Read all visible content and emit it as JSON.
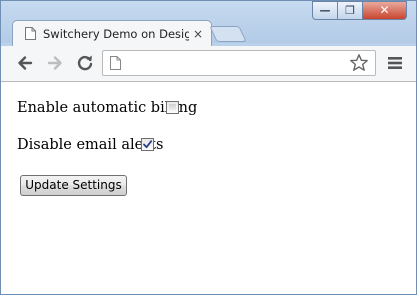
{
  "browser": {
    "tab": {
      "title": "Switchery Demo on Design",
      "close_glyph": "×",
      "icon": "page-icon"
    },
    "window_controls": {
      "minimize_glyph": "—",
      "maximize_glyph": "❐",
      "close_glyph": "✕"
    },
    "toolbar": {
      "back_icon": "back-arrow-icon",
      "forward_icon": "forward-arrow-icon",
      "reload_icon": "reload-icon",
      "menu_icon": "hamburger-menu-icon",
      "bookmark_icon": "star-icon",
      "address_value": ""
    }
  },
  "page": {
    "fields": [
      {
        "label": "Enable automatic billing",
        "checked": false
      },
      {
        "label": "Disable email alerts",
        "checked": true
      }
    ],
    "submit_label": "Update Settings"
  },
  "colors": {
    "window_frame": "#b9d1ea",
    "close_button": "#c8452f",
    "checkbox_check": "#2b3f8a"
  }
}
